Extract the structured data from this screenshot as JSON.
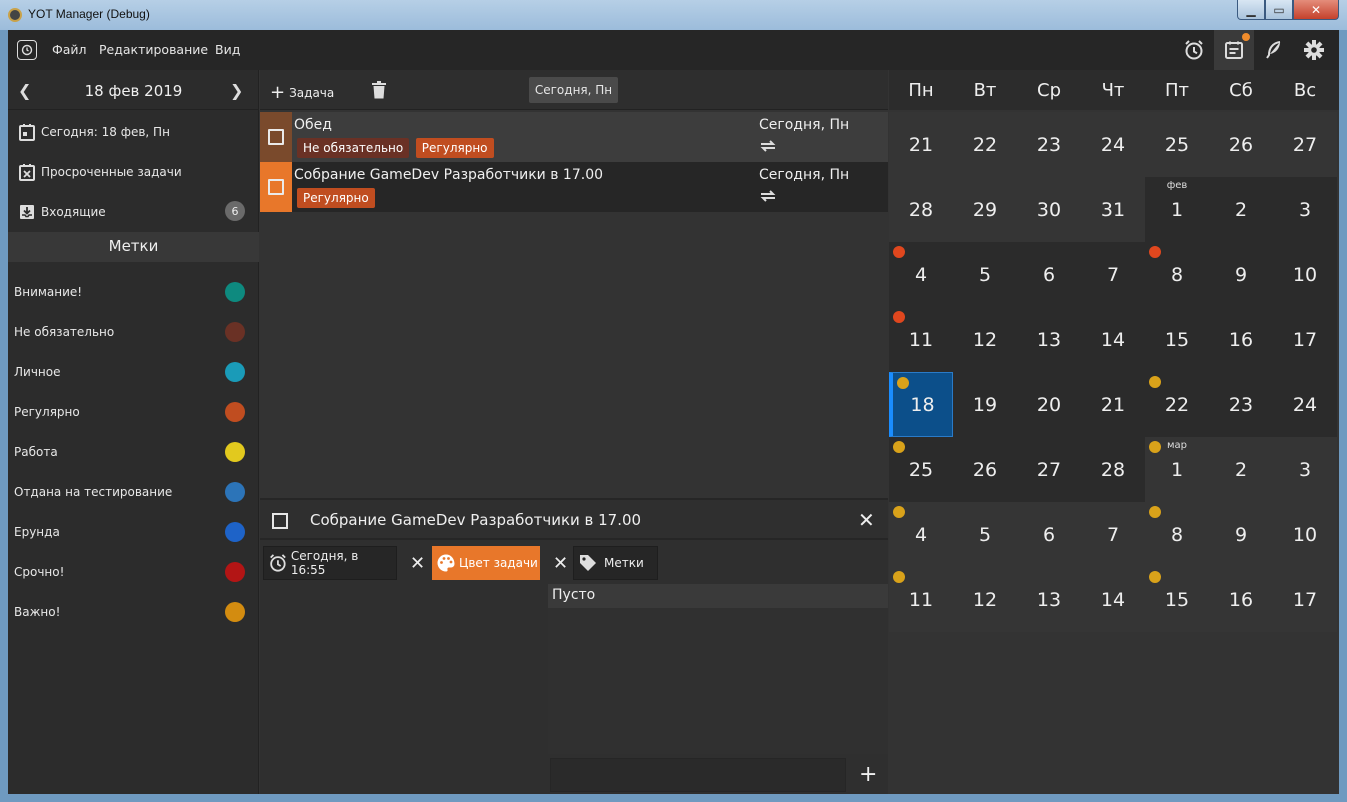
{
  "window": {
    "title": "YOT Manager (Debug)"
  },
  "menu": {
    "file": "Файл",
    "edit": "Редактирование",
    "view": "Вид"
  },
  "top_icons": [
    "alarm-clock-icon",
    "calendar-notes-icon",
    "feather-icon",
    "gear-icon"
  ],
  "sidebar": {
    "date": "18 фев 2019",
    "nav": [
      {
        "label": "Сегодня: 18 фев, Пн",
        "icon": "calendar-today-icon"
      },
      {
        "label": "Просроченные задачи",
        "icon": "calendar-overdue-icon"
      },
      {
        "label": "Входящие",
        "icon": "inbox-icon",
        "badge": "6"
      }
    ],
    "labels_title": "Метки",
    "labels": [
      {
        "name": "Внимание!",
        "color": "#0e8a7f"
      },
      {
        "name": "Не обязательно",
        "color": "#6a3125"
      },
      {
        "name": "Личное",
        "color": "#1a9bb8"
      },
      {
        "name": "Регулярно",
        "color": "#c04d20"
      },
      {
        "name": "Работа",
        "color": "#e2c91e"
      },
      {
        "name": "Отдана на тестирование",
        "color": "#2c74b8"
      },
      {
        "name": "Ерунда",
        "color": "#1e63c8"
      },
      {
        "name": "Срочно!",
        "color": "#b31515"
      },
      {
        "name": "Важно!",
        "color": "#d38c10"
      }
    ]
  },
  "toolbar": {
    "add_task": "Задача",
    "today": "Сегодня, Пн"
  },
  "tasks": [
    {
      "title": "Обед",
      "date": "Сегодня, Пн",
      "color": "#7a4a2c",
      "row_bg": "#3d3d3d",
      "tags": [
        {
          "name": "Не обязательно",
          "color": "#6a3125"
        },
        {
          "name": "Регулярно",
          "color": "#c04d20"
        }
      ]
    },
    {
      "title": "Собрание GameDev Разработчики в 17.00",
      "date": "Сегодня, Пн",
      "color": "#e8772a",
      "row_bg": "#262626",
      "tags": [
        {
          "name": "Регулярно",
          "color": "#c04d20"
        }
      ]
    }
  ],
  "detail": {
    "title": "Собрание GameDev Разработчики в 17.00",
    "due": "Сегодня, в 16:55",
    "color_btn": "Цвет задачи",
    "tags_btn": "Метки",
    "subtasks_empty": "Пусто"
  },
  "calendar": {
    "weekdays": [
      "Пн",
      "Вт",
      "Ср",
      "Чт",
      "Пт",
      "Сб",
      "Вс"
    ],
    "selected": "18",
    "month_labels": {
      "feb": "фев",
      "mar": "мар"
    },
    "weeks": [
      [
        "21",
        "22",
        "23",
        "24",
        "25",
        "26",
        "27"
      ],
      [
        "28",
        "29",
        "30",
        "31",
        "1",
        "2",
        "3"
      ],
      [
        "4",
        "5",
        "6",
        "7",
        "8",
        "9",
        "10"
      ],
      [
        "11",
        "12",
        "13",
        "14",
        "15",
        "16",
        "17"
      ],
      [
        "18",
        "19",
        "20",
        "21",
        "22",
        "23",
        "24"
      ],
      [
        "25",
        "26",
        "27",
        "28",
        "1",
        "2",
        "3"
      ],
      [
        "4",
        "5",
        "6",
        "7",
        "8",
        "9",
        "10"
      ],
      [
        "11",
        "12",
        "13",
        "14",
        "15",
        "16",
        "17"
      ]
    ],
    "dot_colors": {
      "red": "#e0471e",
      "yellow": "#d9a21a"
    }
  }
}
